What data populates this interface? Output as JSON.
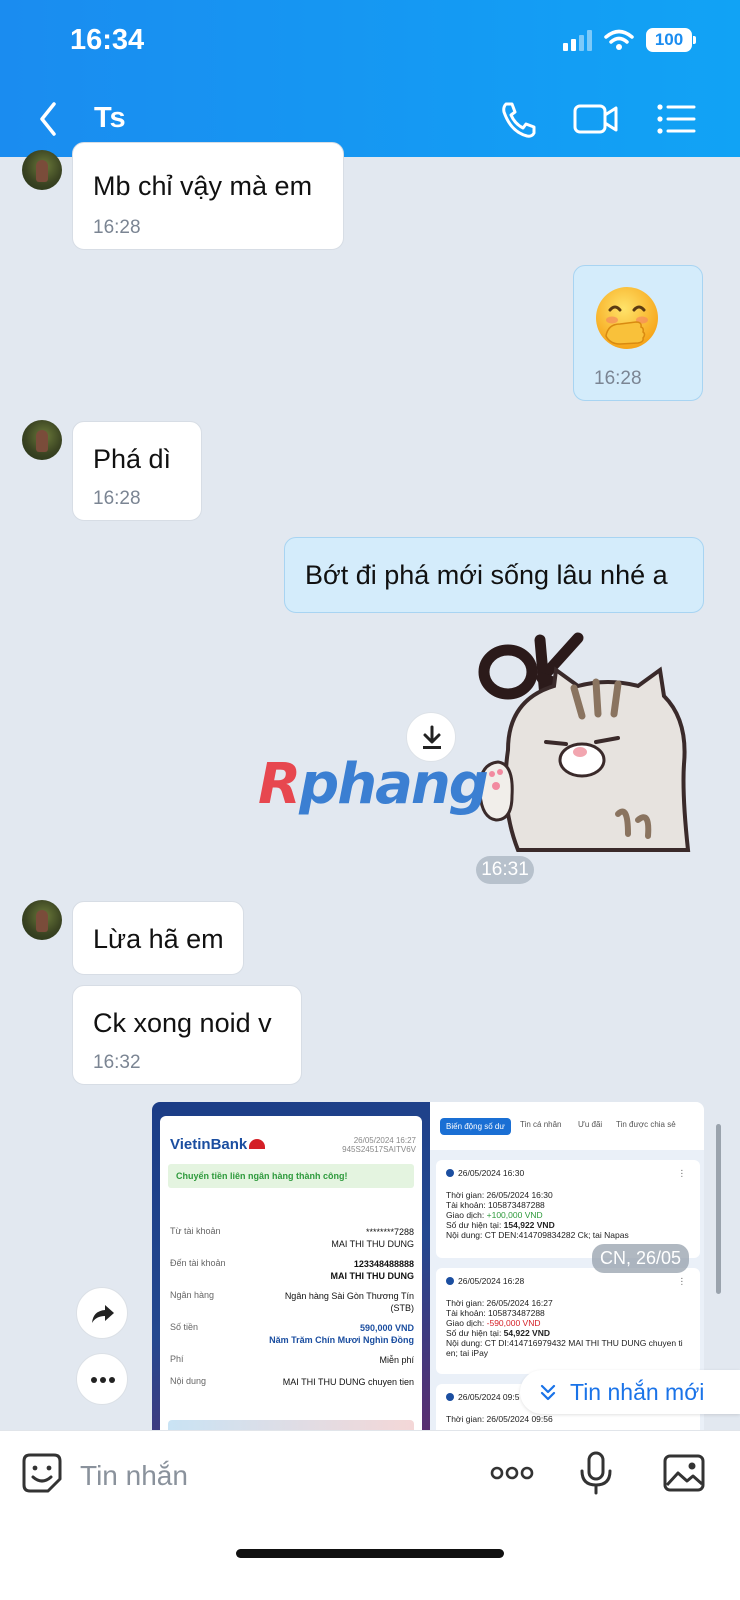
{
  "status_bar": {
    "time": "16:34",
    "battery": "100"
  },
  "header": {
    "title": "Ts"
  },
  "messages": [
    {
      "text": "Mb chỉ vậy mà em",
      "time": "16:28"
    },
    {
      "time": "16:28"
    },
    {
      "text": "Phá dì",
      "time": "16:28"
    },
    {
      "text": "Bớt đi phá mới sống lâu nhé a"
    },
    {
      "time": "16:31"
    },
    {
      "text": "Lừa hã em"
    },
    {
      "text": "Ck xong noid v",
      "time": "16:32"
    }
  ],
  "watermark": {
    "part1": "R",
    "part2": "phang"
  },
  "receipt": {
    "bank": "VietinBank",
    "date": "26/05/2024 16:27",
    "ref": "945S24517SAITV6V",
    "success": "Chuyển tiền liên ngân hàng thành công!",
    "rows": [
      {
        "label": "Từ tài khoản",
        "value": "********7288",
        "sub": "MAI THI THU DUNG"
      },
      {
        "label": "Đến tài khoản",
        "value": "123348488888",
        "sub": "MAI THI THU DUNG"
      },
      {
        "label": "Ngân hàng",
        "value": "Ngân hàng Sài Gòn Thương Tín",
        "sub": "(STB)"
      },
      {
        "label": "Số tiền",
        "value": "590,000 VND",
        "sub": "Năm Trăm Chín Mươi Nghìn Đồng"
      },
      {
        "label": "Phí",
        "value": "Miễn phí",
        "sub": ""
      },
      {
        "label": "Nội dung",
        "value": "MAI THI THU DUNG chuyen tien",
        "sub": ""
      }
    ]
  },
  "history": {
    "tabs": [
      "Biến động số dư",
      "Tin cá nhân",
      "Ưu đãi",
      "Tin được chia sẻ"
    ],
    "cards": [
      {
        "head": "26/05/2024 16:30",
        "lines": [
          "Thời gian: 26/05/2024 16:30",
          "Tài khoản: 105873487288"
        ],
        "tx_label": "Giao dịch: ",
        "tx_value": "+100,000 VND",
        "bal_label": "Số dư hiện tại: ",
        "bal_value": "154,922 VND",
        "content": "Nội dung: CT DEN:414709834282 Ck; tai Napas"
      },
      {
        "head": "26/05/2024 16:28",
        "lines": [
          "Thời gian: 26/05/2024 16:27",
          "Tài khoản: 105873487288"
        ],
        "tx_label": "Giao dịch: ",
        "tx_value": "-590,000 VND",
        "bal_label": "Số dư hiện tại: ",
        "bal_value": "54,922 VND",
        "content": "Nội dung: CT DI:414716979432 MAI THI THU DUNG chuyen ti en; tai iPay"
      },
      {
        "head": "26/05/2024 09:5",
        "lines": [
          "Thời gian: 26/05/2024 09:56"
        ]
      }
    ]
  },
  "date_chip": "CN, 26/05",
  "new_messages": "Tin nhắn mới",
  "input": {
    "placeholder": "Tin nhắn"
  },
  "icons": {
    "back": "chevron-left-icon",
    "call": "phone-icon",
    "video": "video-camera-icon",
    "menu": "list-menu-icon",
    "sticker": "emoji-sticker-icon",
    "more": "more-dots-icon",
    "mic": "microphone-icon",
    "image": "image-gallery-icon",
    "forward": "share-forward-icon",
    "download": "download-icon"
  },
  "colors": {
    "header": "#1a8cf0",
    "my_bubble": "#d4ecfb",
    "chat_bg": "#e2e8f0",
    "link": "#1a73e8"
  }
}
